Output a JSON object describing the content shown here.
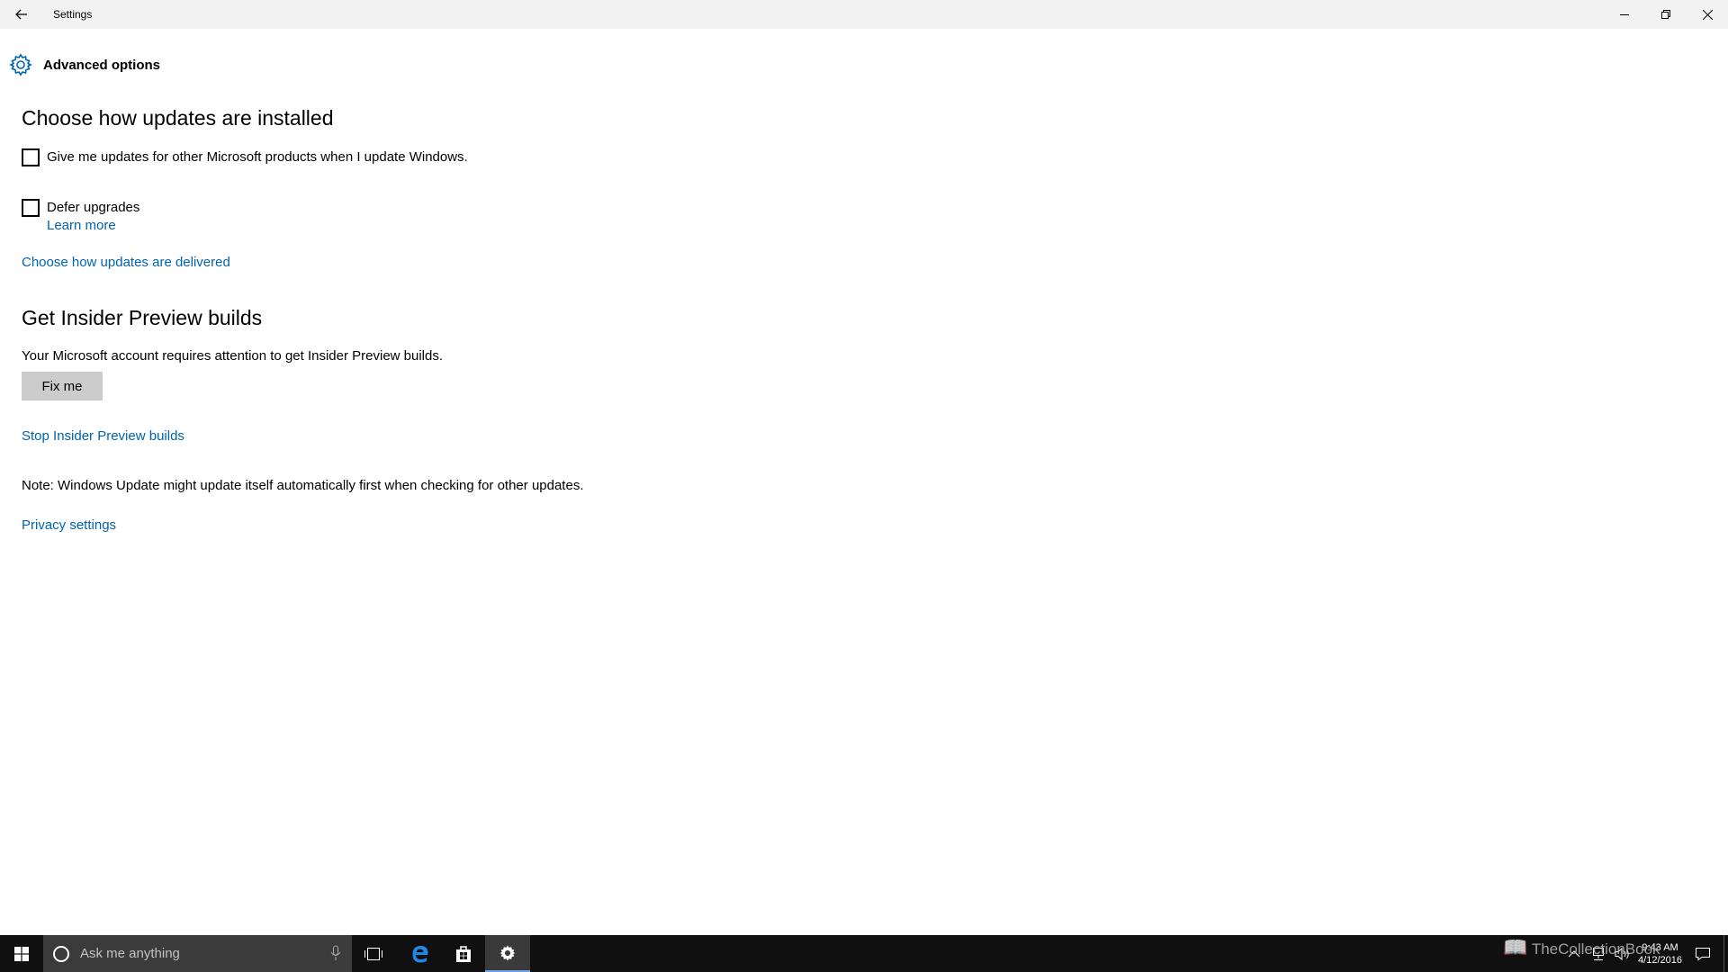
{
  "window": {
    "title": "Settings"
  },
  "header": {
    "title": "Advanced options"
  },
  "install_section": {
    "heading": "Choose how updates are installed",
    "checkbox_other_products": "Give me updates for other Microsoft products when I update Windows.",
    "checkbox_defer": "Defer upgrades",
    "learn_more": "Learn more",
    "delivery_link": "Choose how updates are delivered"
  },
  "insider_section": {
    "heading": "Get Insider Preview builds",
    "message": "Your Microsoft account requires attention to get Insider Preview builds.",
    "fix_button": "Fix me",
    "stop_link": "Stop Insider Preview builds"
  },
  "note": "Note: Windows Update might update itself automatically first when checking for other updates.",
  "privacy_link": "Privacy settings",
  "taskbar": {
    "search_placeholder": "Ask me anything",
    "time": "9:43 AM",
    "date": "4/12/2016",
    "watermark": "TheCollectionBook"
  },
  "colors": {
    "accent": "#0063b1",
    "button_bg": "#cccccc",
    "taskbar_bg": "#101010"
  }
}
